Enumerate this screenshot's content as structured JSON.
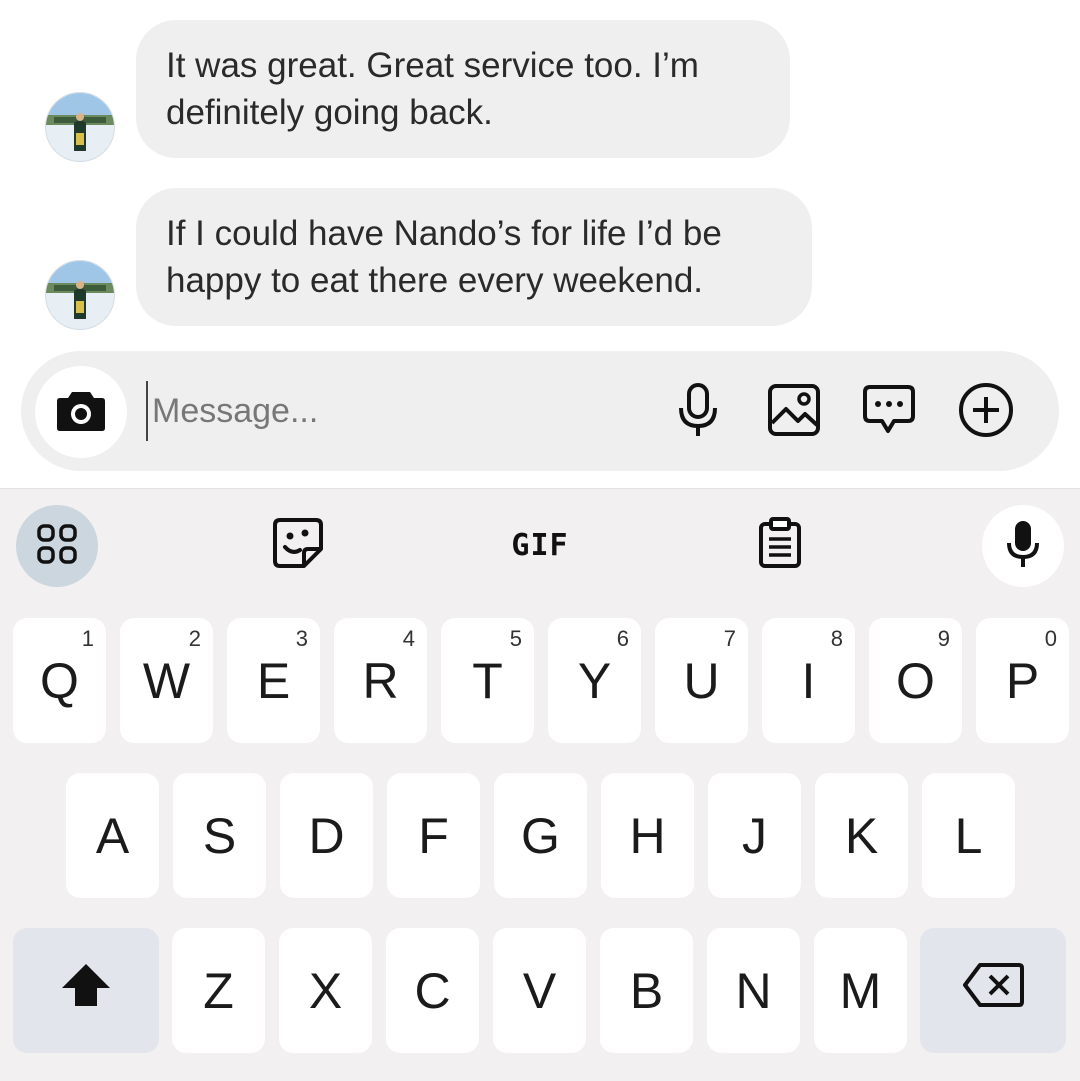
{
  "messages": [
    {
      "line1": "It was great. Great service too. I’m",
      "line2": "definitely going back."
    },
    {
      "line1": "If I could have Nando’s for life I’d be",
      "line2": "happy to eat there every weekend."
    }
  ],
  "composer": {
    "placeholder": "Message...",
    "icons": [
      "camera-icon",
      "microphone-icon",
      "image-icon",
      "chat-bubble-icon",
      "plus-circle-icon"
    ]
  },
  "keyboard_toolbar": {
    "gif_label": "GIF",
    "icons": [
      "grid-icon",
      "sticker-icon",
      "clipboard-icon",
      "microphone-icon"
    ]
  },
  "keyboard": {
    "row1": [
      {
        "label": "Q",
        "num": "1"
      },
      {
        "label": "W",
        "num": "2"
      },
      {
        "label": "E",
        "num": "3"
      },
      {
        "label": "R",
        "num": "4"
      },
      {
        "label": "T",
        "num": "5"
      },
      {
        "label": "Y",
        "num": "6"
      },
      {
        "label": "U",
        "num": "7"
      },
      {
        "label": "I",
        "num": "8"
      },
      {
        "label": "O",
        "num": "9"
      },
      {
        "label": "P",
        "num": "0"
      }
    ],
    "row2": [
      "A",
      "S",
      "D",
      "F",
      "G",
      "H",
      "J",
      "K",
      "L"
    ],
    "row3": [
      "Z",
      "X",
      "C",
      "V",
      "B",
      "N",
      "M"
    ],
    "special_icons": [
      "shift-icon",
      "backspace-icon"
    ]
  },
  "colors": {
    "bubble": "#efefef",
    "keyboard_bg": "#f2f0f1",
    "special_key": "#e2e6ec",
    "grid_button": "#ccd6df"
  }
}
